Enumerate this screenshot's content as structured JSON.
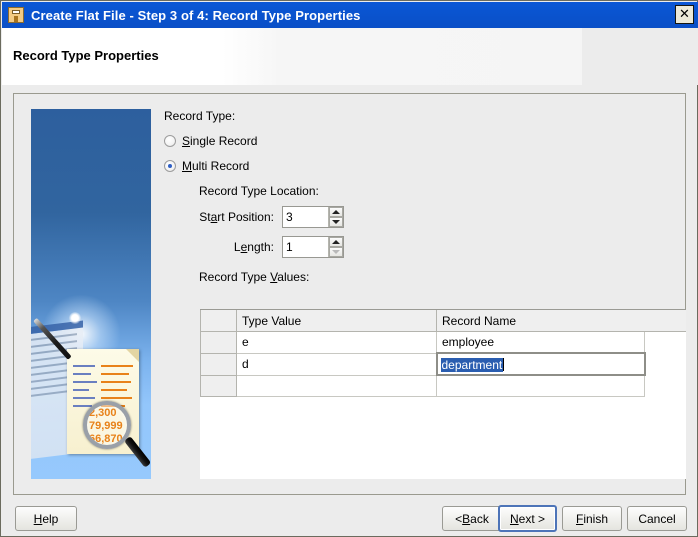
{
  "window": {
    "title": "Create Flat File - Step 3 of 4: Record Type Properties",
    "icon": "wizard-file-icon",
    "close_label": "✕"
  },
  "header": {
    "title": "Record Type Properties"
  },
  "side_image": {
    "alt": "wizard-illustration",
    "magnifier_numbers": [
      "2,300",
      "79,999",
      "66,870"
    ]
  },
  "form": {
    "record_type_label": "Record Type:",
    "options": [
      {
        "label_pre": "S",
        "label_post": "ingle Record",
        "selected": false,
        "name": "single-record"
      },
      {
        "label_pre": "M",
        "label_post": "ulti Record",
        "selected": true,
        "name": "multi-record"
      }
    ],
    "location_label": "Record Type Location:",
    "start_position": {
      "label_pre": "St",
      "label_mid": "a",
      "label_post": "rt Position:",
      "value": "3"
    },
    "length": {
      "label_pre": "L",
      "label_mid": "e",
      "label_post": "ngth:",
      "value": "1"
    },
    "values_label_pre": "Record Type ",
    "values_label_mid": "V",
    "values_label_post": "alues:"
  },
  "table": {
    "columns": [
      "",
      "Type Value",
      "Record Name"
    ],
    "rows": [
      {
        "type_value": "e",
        "record_name": "employee",
        "editing": false
      },
      {
        "type_value": "d",
        "record_name": "department",
        "editing": true
      },
      {
        "type_value": "",
        "record_name": "",
        "editing": false
      }
    ]
  },
  "buttons": {
    "help": {
      "pre": "",
      "key": "H",
      "post": "elp"
    },
    "back": {
      "pre": "< ",
      "key": "B",
      "post": "ack"
    },
    "next": {
      "pre": "",
      "key": "N",
      "post": "ext >",
      "focused": true
    },
    "finish": {
      "pre": "",
      "key": "F",
      "post": "inish"
    },
    "cancel": {
      "pre": "Cancel",
      "key": "",
      "post": ""
    }
  },
  "colors": {
    "titlebar": "#0b55d4",
    "selection": "#2a5db0",
    "panel": "#ececec",
    "accent_blue": "#2f5fc4"
  }
}
